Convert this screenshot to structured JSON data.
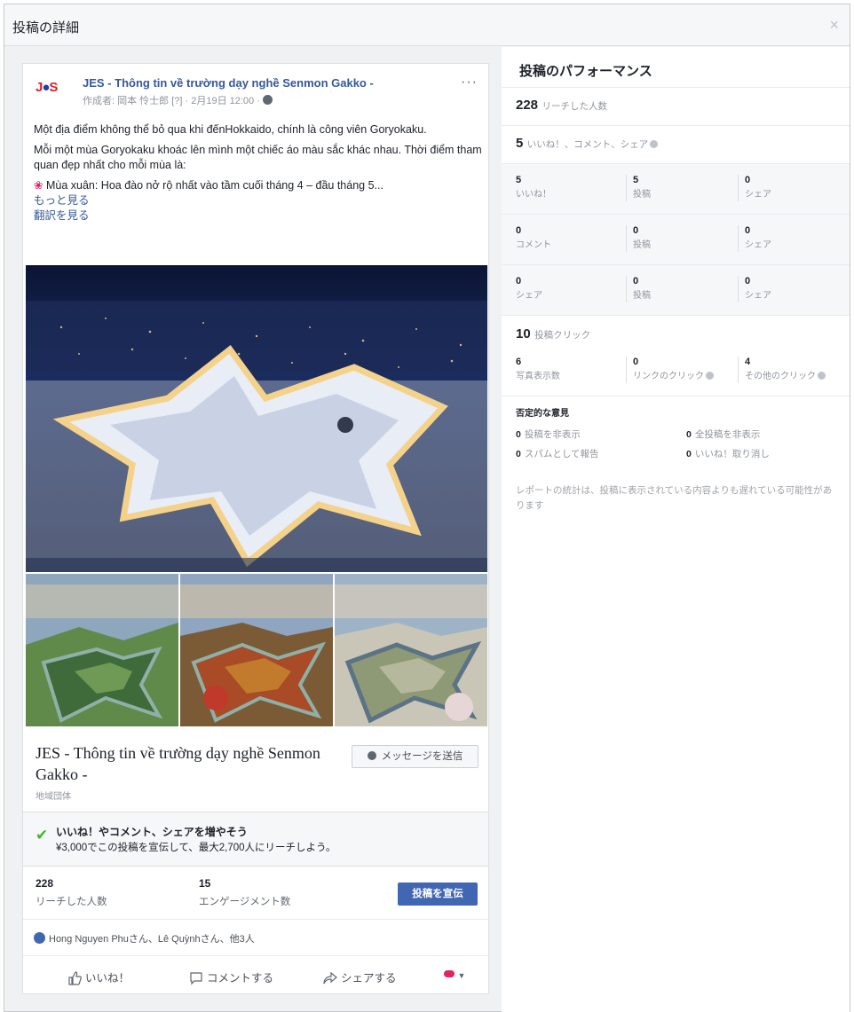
{
  "dialog": {
    "title": "投稿の詳細",
    "close": "×"
  },
  "post": {
    "page_name": "JES - Thông tin về trường dạy nghề Senmon Gakko -",
    "logo_text": "JES",
    "meta": "作成者: 岡本 怜士郎 [?] · 2月19日 12:00 ·",
    "more": "···",
    "text_1": "Một địa điểm không thể bỏ qua khi đếnHokkaido, chính là công viên Goryokaku.",
    "text_2": "Mỗi một mùa Goryokaku khoác lên mình một chiếc áo màu sắc khác nhau. Thời điểm tham quan đẹp nhất cho mỗi mùa là:",
    "text_3_icon": "❀",
    "text_3": "Mùa xuân: Hoa đào nở rộ nhất vào tầm cuối tháng 4 – đầu tháng 5...",
    "see_more": "もっと見る",
    "see_translation": "翻訳を見る",
    "page_block_title": "JES - Thông tin về trường dạy nghề Senmon Gakko -",
    "page_category": "地域団体",
    "send_message": "メッセージを送信",
    "promo_title": "いいね！やコメント、シェアを増やそう",
    "promo_sub": "¥3,000でこの投稿を宣伝して、最大2,700人にリーチしよう。",
    "reach_num": "228",
    "reach_label": "リーチした人数",
    "engage_num": "15",
    "engage_label": "エンゲージメント数",
    "boost_label": "投稿を宣伝",
    "reactions": "Hong Nguyen Phuさん、Lê Quỳnhさん、他3人",
    "act_like": "いいね！",
    "act_comment": "コメントする",
    "act_share": "シェアする"
  },
  "performance": {
    "title": "投稿のパフォーマンス",
    "reach_num": "228",
    "reach_label": "リーチした人数",
    "eng_num": "5",
    "eng_label": "いいね！、コメント、シェア",
    "grid": [
      [
        {
          "n": "5",
          "l": "いいね！"
        },
        {
          "n": "5",
          "l": "投稿"
        },
        {
          "n": "0",
          "l": "シェア"
        }
      ],
      [
        {
          "n": "0",
          "l": "コメント"
        },
        {
          "n": "0",
          "l": "投稿"
        },
        {
          "n": "0",
          "l": "シェア"
        }
      ],
      [
        {
          "n": "0",
          "l": "シェア"
        },
        {
          "n": "0",
          "l": "投稿"
        },
        {
          "n": "0",
          "l": "シェア"
        }
      ]
    ],
    "clicks_num": "10",
    "clicks_label": "投稿クリック",
    "click_cells": [
      {
        "n": "6",
        "l": "写真表示数"
      },
      {
        "n": "0",
        "l": "リンクのクリック"
      },
      {
        "n": "4",
        "l": "その他のクリック"
      }
    ],
    "negative_head": "否定的な意見",
    "negative": [
      {
        "n": "0",
        "l": "投稿を非表示"
      },
      {
        "n": "0",
        "l": "全投稿を非表示"
      },
      {
        "n": "0",
        "l": "スパムとして報告"
      },
      {
        "n": "0",
        "l": "いいね！取り消し"
      }
    ],
    "note": "レポートの統計は、投稿に表示されている内容よりも遅れている可能性があります"
  },
  "colors": {
    "link": "#365899",
    "brand_blue": "#4267b2",
    "check_green": "#42b72a"
  }
}
